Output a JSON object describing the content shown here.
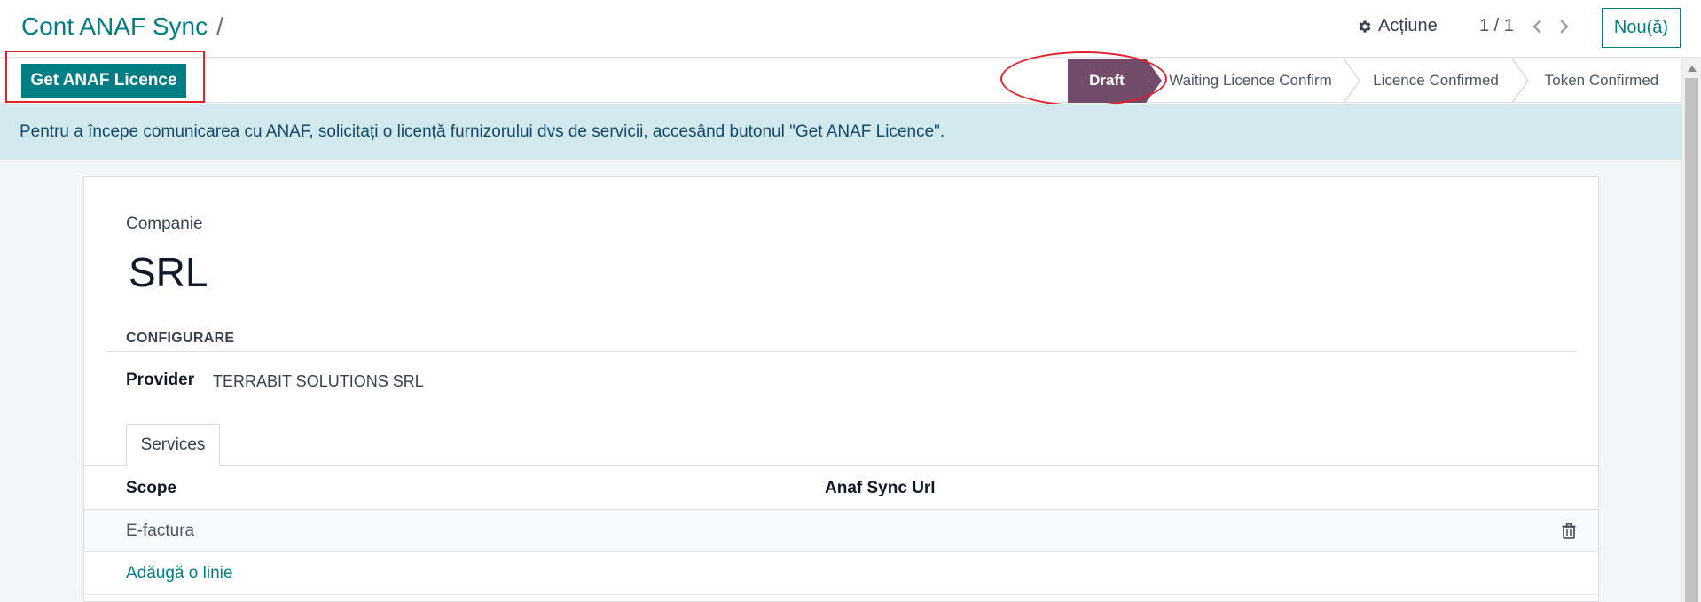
{
  "breadcrumb": {
    "title": "Cont ANAF Sync",
    "separator": "/"
  },
  "header": {
    "actions_label": "Acțiune",
    "actions_icon": "gear-icon",
    "pager": "1 / 1",
    "new_label": "Nou(ă)"
  },
  "toolbar": {
    "licence_button": "Get ANAF Licence"
  },
  "status": {
    "stages": [
      "Draft",
      "Waiting Licence Confirm",
      "Licence Confirmed",
      "Token Confirmed"
    ],
    "active": "Draft"
  },
  "alert": {
    "text": "Pentru a începe comunicarea cu ANAF, solicitați o licență furnizorului dvs de servicii, accesând butonul \"Get ANAF Licence\"."
  },
  "form": {
    "company_label": "Companie",
    "company_value": "SRL",
    "section_title": "CONFIGURARE",
    "provider_label": "Provider",
    "provider_value": "TERRABIT SOLUTIONS SRL"
  },
  "tabs": [
    {
      "label": "Services"
    }
  ],
  "services_table": {
    "columns": [
      "Scope",
      "Anaf Sync Url"
    ],
    "rows": [
      {
        "scope": "E-factura",
        "url": ""
      }
    ],
    "add_line": "Adăugă o linie"
  },
  "colors": {
    "primary": "#017e84",
    "status_active": "#714b67",
    "alert_bg": "#d2eaee",
    "annotation_red": "#e0222b"
  }
}
